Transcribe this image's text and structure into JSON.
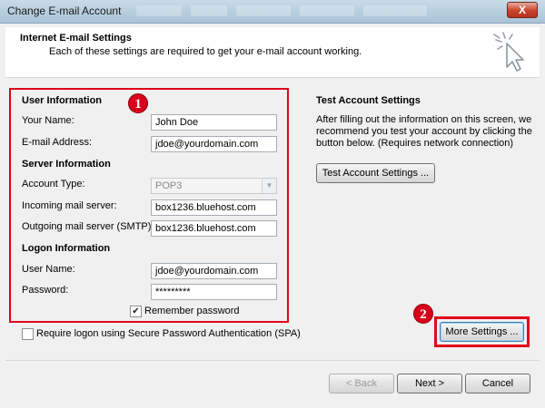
{
  "window": {
    "title": "Change E-mail Account",
    "close_label": "X"
  },
  "header": {
    "title": "Internet E-mail Settings",
    "subtitle": "Each of these settings are required to get your e-mail account working."
  },
  "user_info": {
    "title": "User Information",
    "name_label": "Your Name:",
    "name_value": "John Doe",
    "email_label": "E-mail Address:",
    "email_value": "jdoe@yourdomain.com"
  },
  "server_info": {
    "title": "Server Information",
    "account_type_label": "Account Type:",
    "account_type_value": "POP3",
    "incoming_label": "Incoming mail server:",
    "incoming_value": "box1236.bluehost.com",
    "outgoing_label": "Outgoing mail server (SMTP):",
    "outgoing_value": "box1236.bluehost.com"
  },
  "logon_info": {
    "title": "Logon Information",
    "username_label": "User Name:",
    "username_value": "jdoe@yourdomain.com",
    "password_label": "Password:",
    "password_value": "*********",
    "remember_label": "Remember password",
    "remember_checked": true,
    "spa_label": "Require logon using Secure Password Authentication (SPA)",
    "spa_checked": false
  },
  "test_settings": {
    "title": "Test Account Settings",
    "description_1": "After filling out the information on this screen, we",
    "description_2": "recommend you test your account by clicking the",
    "description_3": "button below. (Requires network connection)",
    "button_label": "Test Account Settings ..."
  },
  "annotations": {
    "badge_1": "1",
    "badge_2": "2"
  },
  "buttons": {
    "more_settings": "More Settings ...",
    "back": "< Back",
    "next": "Next >",
    "cancel": "Cancel"
  },
  "colors": {
    "annotation_red": "#e1001a",
    "titlebar": "#b9d1e3"
  }
}
